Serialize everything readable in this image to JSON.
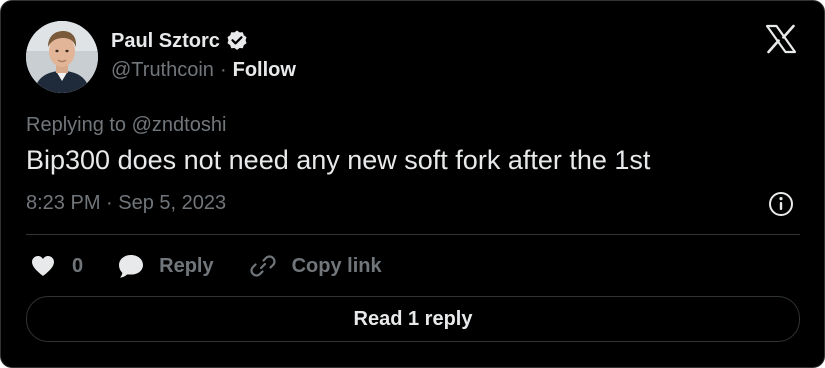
{
  "author": {
    "name": "Paul Sztorc",
    "handle": "@Truthcoin",
    "separator": "·",
    "follow_label": "Follow",
    "verified": true
  },
  "tweet": {
    "replying_to_prefix": "Replying to ",
    "replying_to_handle": "@zndtoshi",
    "text": "Bip300 does not need any new soft fork after the 1st",
    "timestamp": "8:23 PM · Sep 5, 2023"
  },
  "actions": {
    "like_count": "0",
    "reply_label": "Reply",
    "copy_link_label": "Copy link"
  },
  "read_replies_label": "Read 1 reply",
  "icons": {
    "brand": "x-logo-icon",
    "verified": "verified-badge-icon",
    "info": "info-icon",
    "like": "heart-icon",
    "reply": "reply-bubble-icon",
    "copy_link": "link-icon"
  },
  "colors": {
    "background": "#000000",
    "text_primary": "#e7e9ea",
    "text_secondary": "#71767b",
    "border": "#2f3336"
  }
}
